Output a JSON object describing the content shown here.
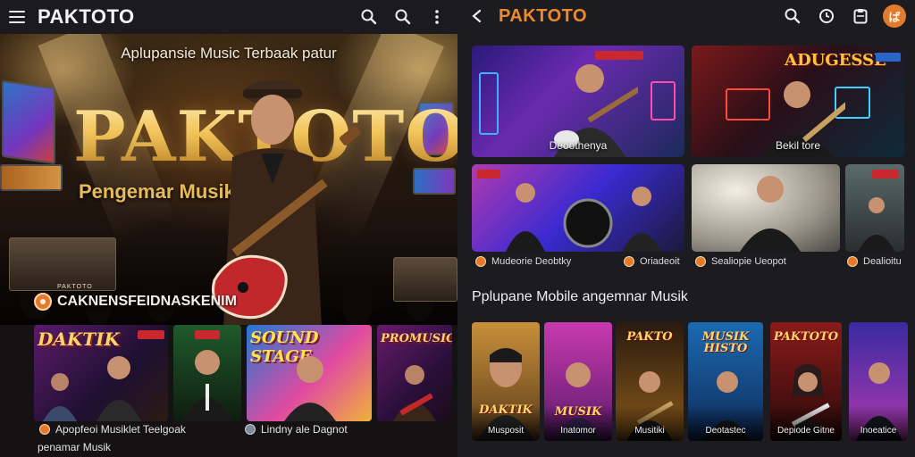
{
  "left": {
    "app_bar": {
      "brand": "PAKTOTO",
      "icons": [
        "menu-icon",
        "search-icon",
        "search-icon",
        "more-vert-icon"
      ]
    },
    "hero": {
      "tagline": "Aplupansie Music Terbaak patur",
      "title": "PAKTOTO",
      "subtitle": "Pengemar Musik",
      "badge_text": "CAKNENSFEIDNASKENIM",
      "badge_small": "PAKTOTO"
    },
    "cards": [
      {
        "title": "DAKTIK"
      },
      {
        "title": ""
      },
      {
        "title": "SOUND STAGE"
      },
      {
        "title": "PROMUSIC"
      }
    ],
    "captions": {
      "cap1": "Apopfeoi Musiklet Teelgoak",
      "cap2": "Lindny ale Dagnot",
      "cap3": "penamar Musik"
    }
  },
  "right": {
    "app_bar": {
      "brand": "PAKTOTO",
      "icons": [
        "back-icon",
        "search-icon",
        "clock-icon",
        "clipboard-icon"
      ],
      "avatar": "ば"
    },
    "featured": [
      {
        "caption": "Deoothenya"
      },
      {
        "caption": "Bekil tore",
        "banner": "ADUGESSE"
      }
    ],
    "row2_captions": [
      "Mudeorie Deobtky",
      "Oriadeoit",
      "Sealiopie Ueopot",
      "Dealioitu"
    ],
    "section_title": "Pplupane Mobile angemnar Musik",
    "posters": [
      {
        "title": "DAKTIK",
        "caption": "Musposit"
      },
      {
        "title": "MUSIK",
        "caption": "Inatomor"
      },
      {
        "title": "PAKTO",
        "caption": "Musitiki"
      },
      {
        "title": "MUSIK HISTO",
        "caption": "Deotastec"
      },
      {
        "title": "PAKTOTO",
        "caption": "Depiode Gitne"
      },
      {
        "title": "",
        "caption": "Inoeatice"
      }
    ]
  }
}
